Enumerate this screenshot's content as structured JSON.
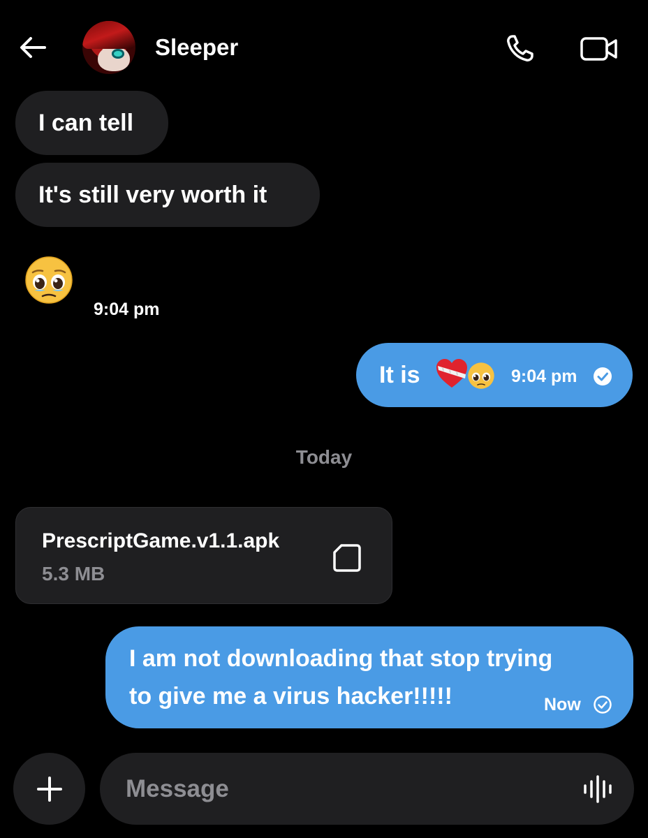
{
  "header": {
    "back_icon": "arrow-left-icon",
    "contact_name": "Sleeper",
    "call_icon": "phone-icon",
    "video_icon": "video-camera-icon"
  },
  "messages": {
    "in1": "I can tell",
    "in2": "It's still very worth it",
    "in3_emoji": "pleading-face-emoji",
    "in3_time": "9:04 pm",
    "out1_text": "It is",
    "out1_emojis": [
      "mending-heart-emoji",
      "pleading-face-emoji"
    ],
    "out1_time": "9:04 pm",
    "out1_status_icon": "check-circle-filled-icon",
    "date_separator": "Today",
    "file_name": "PrescriptGame.v1.1.apk",
    "file_size": "5.3 MB",
    "file_icon": "file-icon",
    "out2_line1": "I am not downloading that stop trying",
    "out2_line2": "to give me a virus hacker!!!!!",
    "out2_time": "Now",
    "out2_status_icon": "check-circle-outline-icon"
  },
  "composer": {
    "plus_icon": "plus-icon",
    "placeholder": "Message",
    "voice_icon": "audio-waveform-icon"
  },
  "colors": {
    "background": "#000000",
    "incoming_bubble": "#1f1f21",
    "outgoing_bubble": "#4a9be5",
    "muted_text": "#8e8e93"
  }
}
